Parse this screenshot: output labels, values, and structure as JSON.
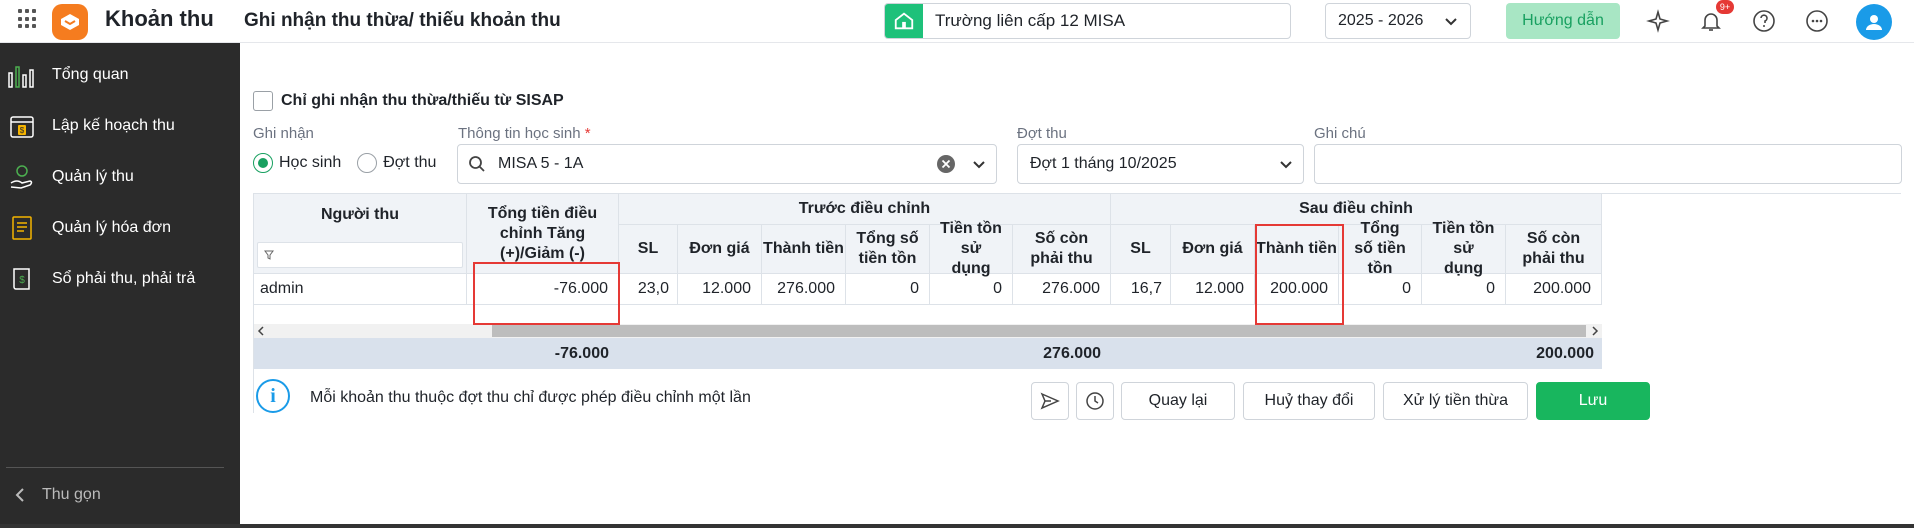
{
  "app": {
    "name": "Khoản thu",
    "page_title": "Ghi nhận thu thừa/ thiếu khoản thu"
  },
  "header": {
    "school": "Trường liên cấp 12 MISA",
    "year": "2025 - 2026",
    "guide_label": "Hướng dẫn",
    "notification_badge": "9+",
    "icons": [
      "grid-icon",
      "school-icon",
      "sparkle-icon",
      "bell-icon",
      "help-icon",
      "more-icon",
      "user-avatar"
    ]
  },
  "sidebar": {
    "items": [
      {
        "label": "Tổng quan",
        "icon": "chart-icon"
      },
      {
        "label": "Lập kế hoạch thu",
        "icon": "calendar-money-icon"
      },
      {
        "label": "Quản lý thu",
        "icon": "hand-money-icon"
      },
      {
        "label": "Quản lý hóa đơn",
        "icon": "invoice-icon"
      },
      {
        "label": "Sổ phải thu, phải trả",
        "icon": "ledger-icon"
      }
    ],
    "collapse_label": "Thu gọn"
  },
  "form": {
    "sisap_checkbox_label": "Chỉ ghi nhận thu thừa/thiếu từ SISAP",
    "record_label": "Ghi nhận",
    "radio_student": "Học sinh",
    "radio_period": "Đợt thu",
    "student_info_label": "Thông tin học sinh",
    "student_value": "MISA 5 - 1A",
    "period_label": "Đợt thu",
    "period_value": "Đợt 1 tháng 10/2025",
    "note_label": "Ghi chú",
    "note_value": ""
  },
  "table": {
    "col_collector": "Người thu",
    "col_total_adjust": "Tổng tiền điều chỉnh Tăng (+)/Giảm (-)",
    "group_before": "Trước điều chỉnh",
    "group_after": "Sau điều chỉnh",
    "sub": {
      "sl": "SL",
      "unit_price": "Đơn giá",
      "amount": "Thành tiền",
      "total_balance": "Tổng số tiền tồn",
      "balance_used": "Tiền tồn sử dụng",
      "remaining": "Số còn phải thu"
    },
    "row": {
      "collector": "admin",
      "total_adjust": "-76.000",
      "before": {
        "sl": "23,0",
        "unit_price": "12.000",
        "amount": "276.000",
        "total_balance": "0",
        "balance_used": "0",
        "remaining": "276.000"
      },
      "after": {
        "sl": "16,7",
        "unit_price": "12.000",
        "amount": "200.000",
        "total_balance": "0",
        "balance_used": "0",
        "remaining": "200.000"
      }
    },
    "footer": {
      "total_adjust": "-76.000",
      "before_remaining": "276.000",
      "after_remaining": "200.000"
    }
  },
  "footer_bar": {
    "info_text": "Mỗi khoản thu thuộc đợt thu chỉ được phép điều chỉnh một lần",
    "back_label": "Quay lại",
    "discard_label": "Huỷ thay đổi",
    "excess_label": "Xử lý tiền thừa",
    "save_label": "Lưu"
  }
}
